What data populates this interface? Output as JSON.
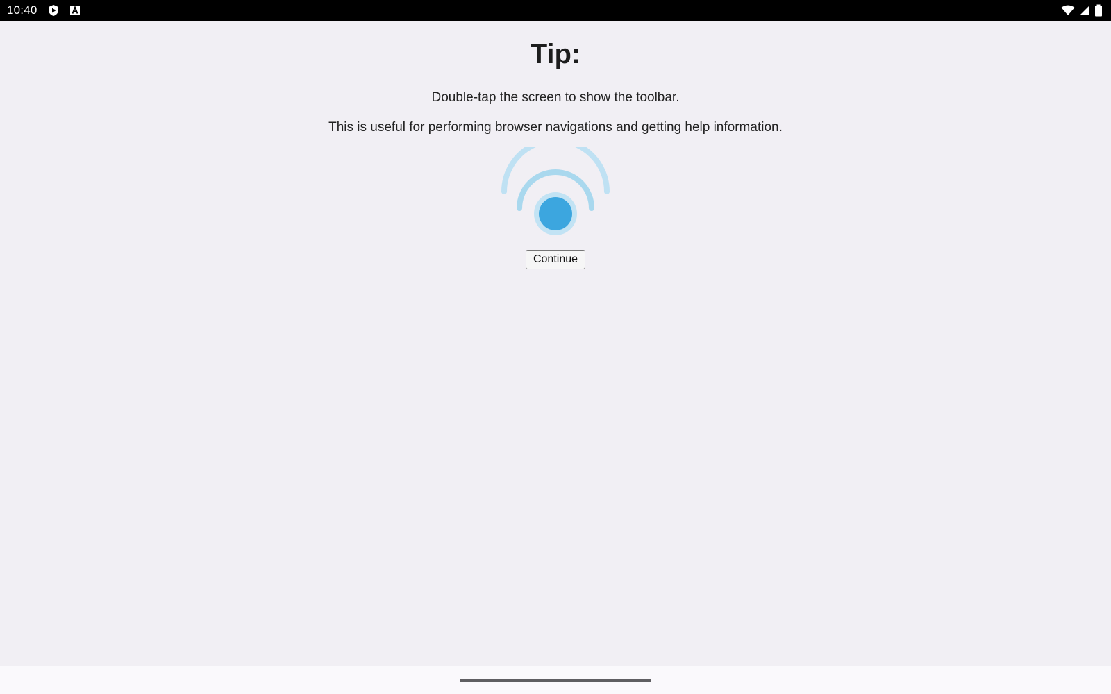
{
  "status_bar": {
    "time": "10:40",
    "left_icons": [
      "shield-play-icon",
      "keyboard-a-icon"
    ],
    "right_icons": [
      "wifi-icon",
      "cellular-signal-icon",
      "battery-icon"
    ]
  },
  "tip": {
    "title": "Tip:",
    "line1": "Double-tap the screen to show the toolbar.",
    "line2": "This is useful for performing browser navigations and getting help information."
  },
  "graphic": {
    "icon": "double-tap-gesture-icon",
    "dot_color": "#3ca6df",
    "ring_color": "#a9d8ee"
  },
  "actions": {
    "continue_label": "Continue"
  },
  "nav_bar": {
    "icon": "home-gesture-handle"
  }
}
